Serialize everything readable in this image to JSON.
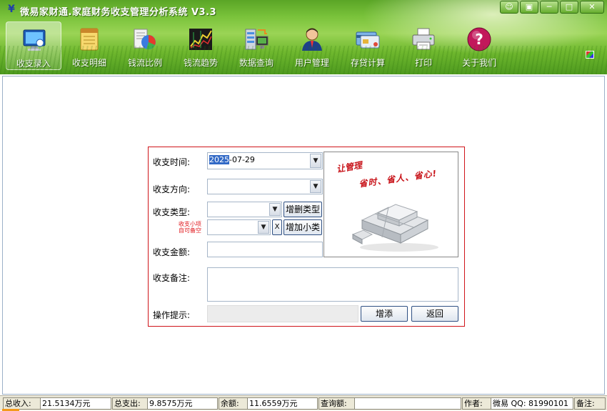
{
  "window": {
    "title": "微易家财通.家庭财务收支管理分析系统 V3.3",
    "logo_glyph": "¥",
    "controls": [
      "☺",
      "▣",
      "─",
      "□",
      "✕"
    ]
  },
  "toolbar": {
    "items": [
      {
        "label": "收支录入",
        "icon": "monitor-icon",
        "active": true
      },
      {
        "label": "收支明细",
        "icon": "notepad-icon",
        "active": false
      },
      {
        "label": "钱流比例",
        "icon": "pie-chart-icon",
        "active": false
      },
      {
        "label": "钱流趋势",
        "icon": "stock-chart-icon",
        "active": false
      },
      {
        "label": "数据查询",
        "icon": "server-query-icon",
        "active": false
      },
      {
        "label": "用户管理",
        "icon": "user-icon",
        "active": false
      },
      {
        "label": "存贷计算",
        "icon": "credit-card-icon",
        "active": false
      },
      {
        "label": "打印",
        "icon": "printer-icon",
        "active": false
      },
      {
        "label": "关于我们",
        "icon": "help-icon",
        "active": false
      }
    ]
  },
  "form": {
    "time_label": "收支时间:",
    "time_year": "2025",
    "time_rest": "-07-29",
    "direction_label": "收支方向:",
    "direction_value": "",
    "type_label": "收支类型:",
    "type_value": "",
    "edit_type_button": "增删类型",
    "subtype_hint": "收支小项\n自可备空",
    "subtype_value": "",
    "clear_glyph": "X",
    "add_subtype_button": "增加小类",
    "amount_label": "收支金额:",
    "amount_value": "",
    "note_label": "收支备注:",
    "note_value": "",
    "hint_label": "操作提示:",
    "hint_value": "",
    "add_button": "增添",
    "back_button": "返回"
  },
  "promo": {
    "line1": "让管理",
    "line2": "省时、省人、省心!"
  },
  "statusbar": {
    "income_label": "总收入:",
    "income_value": "21.5134万元",
    "expense_label": "总支出:",
    "expense_value": "9.8575万元",
    "balance_label": "余额:",
    "balance_value": "11.6559万元",
    "query_label": "查询额:",
    "query_value": "",
    "author_label": "作者:",
    "author_value": "微易 QQ: 81990101",
    "remark_label": "备注:"
  },
  "colors": {
    "form_border": "#d0141a",
    "hint_text_red": "#e0141a",
    "header_green": "#79c23a",
    "selection_blue": "#3169c6"
  }
}
